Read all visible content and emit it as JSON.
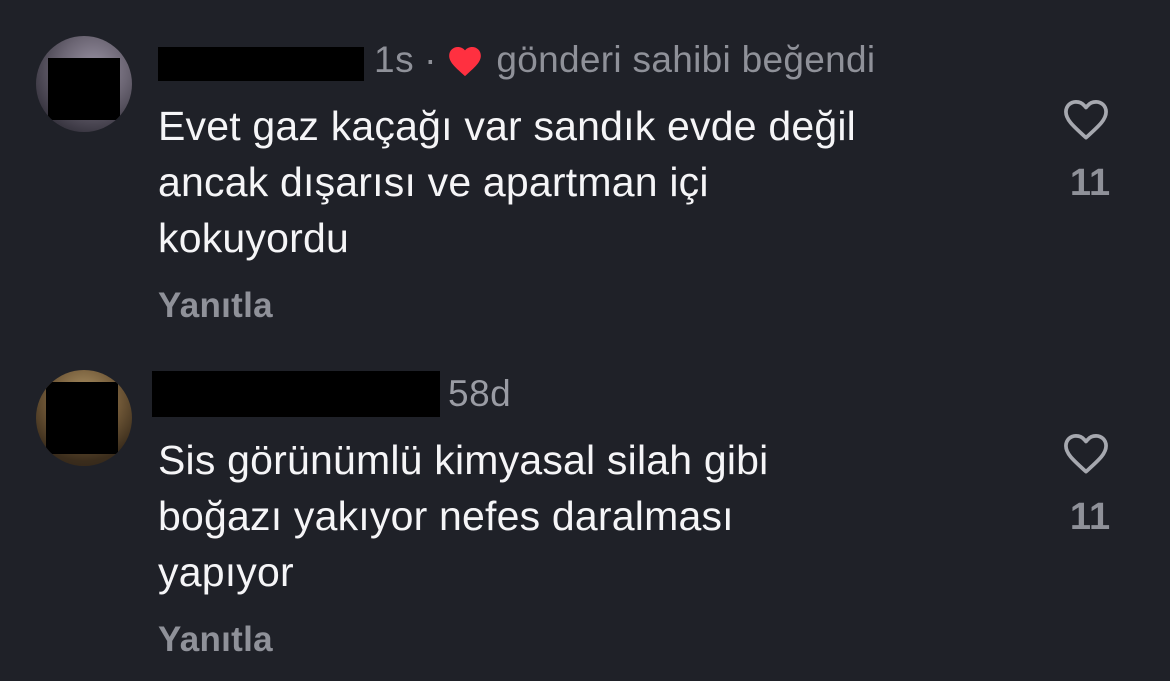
{
  "comments": [
    {
      "timestamp": "1s",
      "separator": "·",
      "owner_liked_text": "gönderi sahibi beğendi",
      "text_lines": [
        "Evet gaz kaçağı var sandık evde değil",
        "ancak dışarısı ve apartman içi",
        "kokuyordu"
      ],
      "reply_label": "Yanıtla",
      "like_count": "11"
    },
    {
      "timestamp": "58d",
      "text_lines": [
        "Sis görünümlü kimyasal silah gibi",
        "boğazı yakıyor nefes daralması",
        "yapıyor"
      ],
      "reply_label": "Yanıtla",
      "like_count": "11"
    }
  ],
  "icons": {
    "like": "heart-outline-icon",
    "owner_liked": "heart-filled-icon"
  },
  "colors": {
    "background": "#1f2128",
    "text_primary": "#f5f5f7",
    "text_secondary": "#8f9199",
    "heart_red": "#ff3040"
  }
}
